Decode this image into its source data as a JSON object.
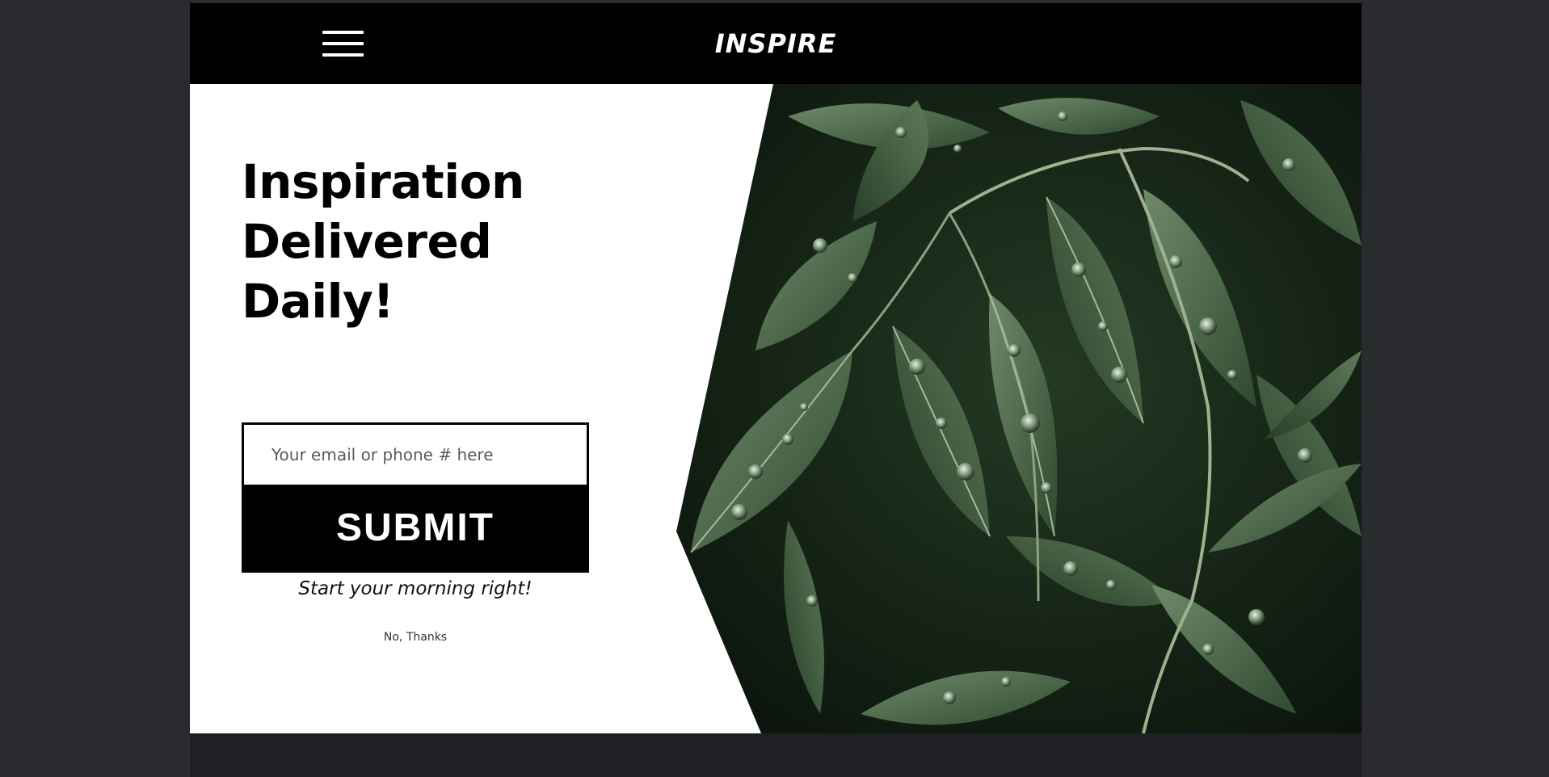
{
  "header": {
    "logo_text": "INSPIRE",
    "menu_icon": "hamburger-menu-icon"
  },
  "hero": {
    "headline": "Inspiration Delivered Daily!",
    "image_subject": "wet green leaves with water droplets"
  },
  "form": {
    "input_placeholder": "Your email or phone # here",
    "input_value": "",
    "submit_label": "SUBMIT"
  },
  "tagline": "Start your morning right!",
  "decline_link": "No, Thanks",
  "colors": {
    "page_background": "#2a2b2e",
    "header_background": "#000000",
    "hero_background": "#ffffff",
    "button_background": "#000000",
    "button_text": "#ffffff",
    "leaf_green": "#3f5a3c"
  }
}
